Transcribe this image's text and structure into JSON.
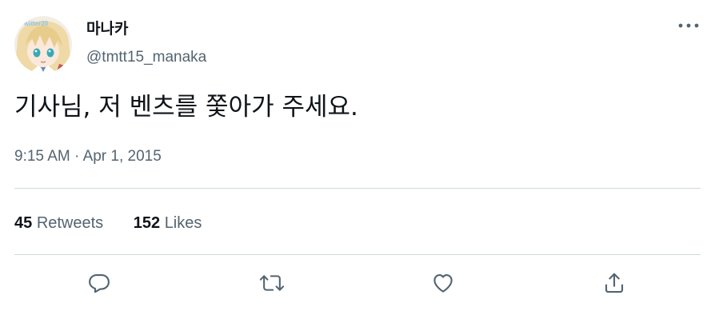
{
  "author": {
    "display_name": "마나카",
    "handle": "@tmtt15_manaka",
    "avatar_text": "witter20"
  },
  "tweet": {
    "text": "기사님, 저 벤츠를 쫓아가 주세요.",
    "time": "9:15 AM",
    "separator": "·",
    "date": "Apr 1, 2015"
  },
  "stats": {
    "retweets_count": "45",
    "retweets_label": "Retweets",
    "likes_count": "152",
    "likes_label": "Likes"
  },
  "icons": {
    "more": "more-horizontal-icon",
    "reply": "reply-icon",
    "retweet": "retweet-icon",
    "like": "heart-icon",
    "share": "share-icon"
  },
  "colors": {
    "primary_text": "#0f1419",
    "secondary_text": "#536471",
    "divider": "#cfd9de"
  }
}
